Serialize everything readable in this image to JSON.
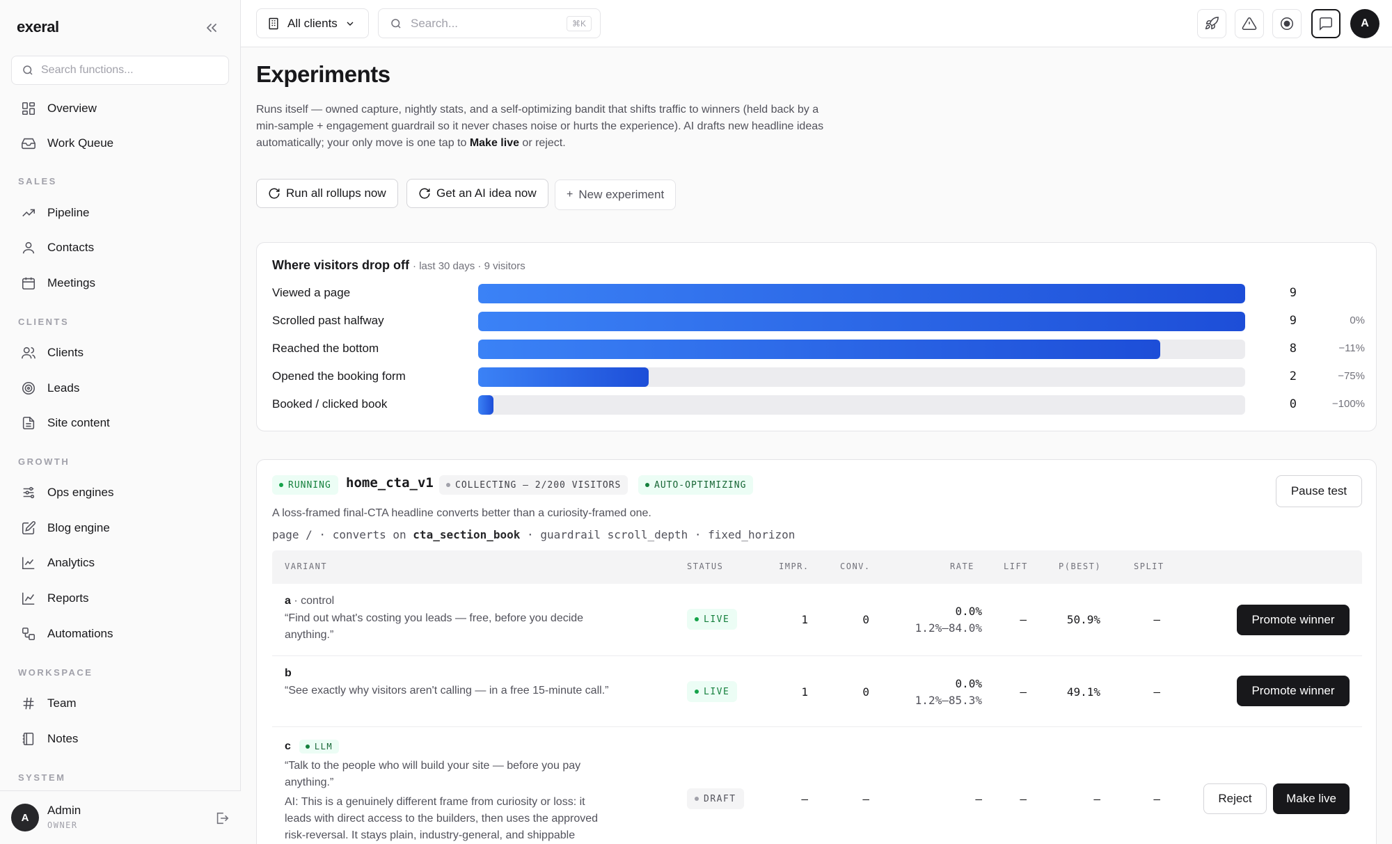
{
  "sidebar": {
    "brand": "exeral",
    "search_placeholder": "Search functions...",
    "top_items": [
      {
        "label": "Overview",
        "icon": "grid-icon"
      },
      {
        "label": "Work Queue",
        "icon": "inbox-icon"
      }
    ],
    "sections": [
      {
        "title": "SALES",
        "items": [
          {
            "label": "Pipeline",
            "icon": "trending-up-icon"
          },
          {
            "label": "Contacts",
            "icon": "user-icon"
          },
          {
            "label": "Meetings",
            "icon": "calendar-icon"
          }
        ]
      },
      {
        "title": "CLIENTS",
        "items": [
          {
            "label": "Clients",
            "icon": "users-icon"
          },
          {
            "label": "Leads",
            "icon": "target-icon"
          },
          {
            "label": "Site content",
            "icon": "file-icon"
          }
        ]
      },
      {
        "title": "GROWTH",
        "items": [
          {
            "label": "Ops engines",
            "icon": "sliders-icon"
          },
          {
            "label": "Blog engine",
            "icon": "edit-icon"
          },
          {
            "label": "Analytics",
            "icon": "line-chart-icon"
          },
          {
            "label": "Reports",
            "icon": "chart-icon"
          },
          {
            "label": "Automations",
            "icon": "workflow-icon"
          }
        ]
      },
      {
        "title": "WORKSPACE",
        "items": [
          {
            "label": "Team",
            "icon": "hash-icon"
          },
          {
            "label": "Notes",
            "icon": "notebook-icon"
          }
        ]
      },
      {
        "title": "SYSTEM",
        "items": []
      }
    ],
    "user": {
      "initial": "A",
      "name": "Admin",
      "role": "OWNER"
    }
  },
  "topbar": {
    "client_select": "All clients",
    "search_placeholder": "Search...",
    "search_shortcut": "⌘K",
    "user_initial": "A"
  },
  "page": {
    "title": "Experiments",
    "desc_1": "Runs itself — owned capture, nightly stats, and a self-optimizing bandit that shifts traffic to winners (held back by a min-sample + engagement guardrail so it never chases noise or hurts the experience). AI drafts new headline ideas automatically; your only move is one tap to ",
    "desc_bold": "Make live",
    "desc_2": " or reject.",
    "buttons": {
      "run_rollups": "Run all rollups now",
      "ai_idea": "Get an AI idea now",
      "new_experiment": "New experiment"
    }
  },
  "funnel": {
    "title": "Where visitors drop off",
    "subtitle": "· last 30 days · 9 visitors",
    "steps": [
      {
        "label": "Viewed a page",
        "count": "9",
        "pct": "",
        "fill": 1.0
      },
      {
        "label": "Scrolled past halfway",
        "count": "9",
        "pct": "0%",
        "fill": 1.0
      },
      {
        "label": "Reached the bottom",
        "count": "8",
        "pct": "−11%",
        "fill": 0.889
      },
      {
        "label": "Opened the booking form",
        "count": "2",
        "pct": "−75%",
        "fill": 0.222
      },
      {
        "label": "Booked / clicked book",
        "count": "0",
        "pct": "−100%",
        "fill": 0.02
      }
    ]
  },
  "experiment": {
    "status": "RUNNING",
    "name": "home_cta_v1",
    "collecting": "COLLECTING — 2/200 VISITORS",
    "optimizing": "AUTO-OPTIMIZING",
    "pause_label": "Pause test",
    "hypothesis": "A loss-framed final-CTA headline converts better than a curiosity-framed one.",
    "meta_prefix": "page / · converts on ",
    "meta_goal": "cta_section_book",
    "meta_suffix": " · guardrail scroll_depth · fixed_horizon",
    "columns": [
      "VARIANT",
      "STATUS",
      "IMPR.",
      "CONV.",
      "RATE",
      "LIFT",
      "P(BEST)",
      "SPLIT"
    ],
    "variants": [
      {
        "key": "a",
        "tag": " · control",
        "text": "“Find out what's costing you leads — free, before you decide anything.”",
        "status": "LIVE",
        "impr": "1",
        "conv": "0",
        "rate": "0.0%",
        "rate_ci": "1.2%–84.0%",
        "lift": "—",
        "pbest": "50.9%",
        "split": "—",
        "action": "Promote winner"
      },
      {
        "key": "b",
        "tag": "",
        "text": "“See exactly why visitors aren't calling — in a free 15-minute call.”",
        "status": "LIVE",
        "impr": "1",
        "conv": "0",
        "rate": "0.0%",
        "rate_ci": "1.2%–85.3%",
        "lift": "—",
        "pbest": "49.1%",
        "split": "—",
        "action": "Promote winner"
      },
      {
        "key": "c",
        "llm": "LLM",
        "text": "“Talk to the people who will build your site — before you pay anything.”",
        "ai_note": "AI: This is a genuinely different frame from curiosity or loss: it leads with direct access to the builders, then uses the approved risk-reversal. It stays plain, industry-general, and shippable without",
        "status": "DRAFT",
        "impr": "—",
        "conv": "—",
        "rate": "—",
        "lift": "—",
        "pbest": "—",
        "split": "—",
        "reject": "Reject",
        "make_live": "Make live"
      }
    ]
  },
  "colors": {
    "accent": "#1d4ed8",
    "live": "#16a34a",
    "dark": "#18181b"
  }
}
